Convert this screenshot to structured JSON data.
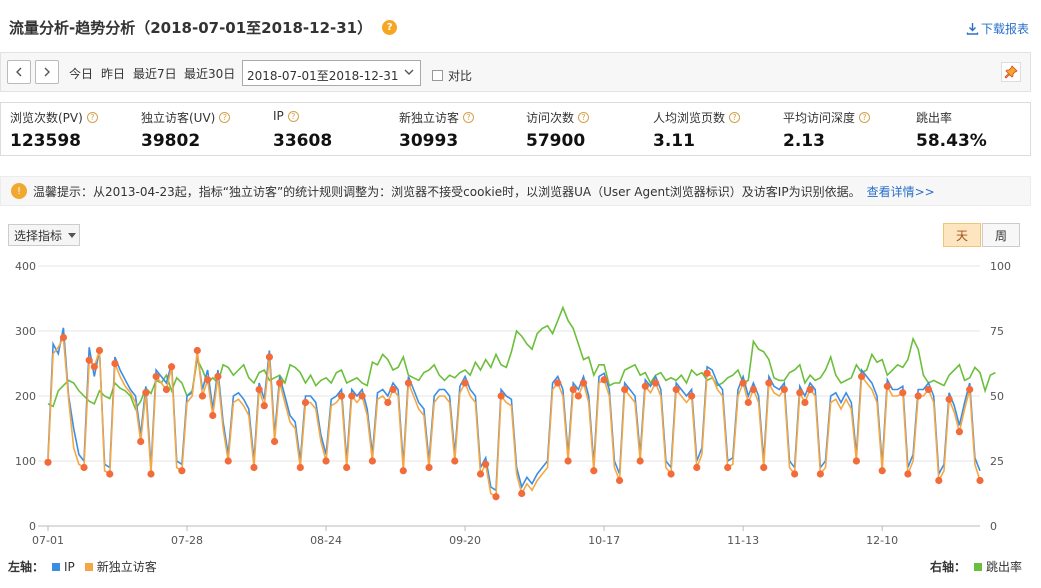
{
  "header": {
    "title": "流量分析-趋势分析（2018-07-01至2018-12-31）",
    "help_icon": "question-icon",
    "download_label": "下载报表",
    "download_icon": "download-icon"
  },
  "toolbar": {
    "prev_icon": "chevron-left-icon",
    "next_icon": "chevron-right-icon",
    "today": "今日",
    "yesterday": "昨日",
    "last7": "最近7日",
    "last30": "最近30日",
    "date_range": "2018-07-01至2018-12-31",
    "compare_label": "对比",
    "compare_checked": false,
    "pin_icon": "pin-icon"
  },
  "metrics": [
    {
      "label": "浏览次数(PV)",
      "value": "123598"
    },
    {
      "label": "独立访客(UV)",
      "value": "39802"
    },
    {
      "label": "IP",
      "value": "33608"
    },
    {
      "label": "新独立访客",
      "value": "30993"
    },
    {
      "label": "访问次数",
      "value": "57900"
    },
    {
      "label": "人均浏览页数",
      "value": "3.11"
    },
    {
      "label": "平均访问深度",
      "value": "2.13"
    },
    {
      "label": "跳出率",
      "value": "58.43%"
    }
  ],
  "notice": {
    "text": "温馨提示：从2013-04-23起，指标“独立访客”的统计规则调整为：浏览器不接受cookie时，以浏览器UA（User Agent浏览器标识）及访客IP为识别依据。",
    "link": "查看详情>>",
    "icon": "info-icon"
  },
  "controls": {
    "select_metric": "选择指标",
    "day": "天",
    "week": "周",
    "active": "day"
  },
  "legend": {
    "left_axis": "左轴：",
    "right_axis": "右轴：",
    "ip": "IP",
    "new_visitors": "新独立访客",
    "bounce": "跳出率"
  },
  "colors": {
    "ip": "#3a8ee6",
    "new_visitors": "#f5a744",
    "bounce": "#6cbf3c",
    "dot": "#f26b3a"
  },
  "chart_data": {
    "type": "line",
    "x_ticks": [
      "07-01",
      "07-28",
      "08-24",
      "09-20",
      "10-17",
      "11-13",
      "12-10"
    ],
    "x_start": "2018-07-01",
    "x_end": "2018-12-31",
    "y_left": {
      "ticks": [
        0,
        100,
        200,
        300,
        400
      ],
      "range": [
        0,
        400
      ]
    },
    "y_right": {
      "ticks": [
        0,
        25,
        50,
        75,
        100
      ],
      "range": [
        0,
        100
      ]
    },
    "grid": true,
    "legend_position": "bottom",
    "series": [
      {
        "name": "IP",
        "axis": "left",
        "values": [
          105,
          280,
          265,
          305,
          200,
          150,
          110,
          100,
          275,
          230,
          270,
          95,
          90,
          260,
          240,
          225,
          210,
          200,
          140,
          215,
          90,
          240,
          230,
          220,
          250,
          100,
          95,
          200,
          205,
          265,
          210,
          240,
          180,
          240,
          160,
          110,
          200,
          205,
          195,
          180,
          100,
          220,
          195,
          270,
          140,
          230,
          200,
          170,
          160,
          100,
          200,
          200,
          190,
          140,
          110,
          195,
          200,
          210,
          100,
          210,
          200,
          210,
          180,
          110,
          205,
          210,
          200,
          220,
          210,
          95,
          230,
          210,
          190,
          180,
          100,
          200,
          210,
          210,
          200,
          110,
          215,
          230,
          210,
          200,
          90,
          105,
          60,
          55,
          210,
          200,
          195,
          90,
          60,
          75,
          65,
          80,
          90,
          100,
          220,
          230,
          210,
          110,
          220,
          210,
          230,
          200,
          95,
          230,
          235,
          210,
          100,
          80,
          220,
          210,
          200,
          110,
          225,
          215,
          230,
          210,
          100,
          90,
          220,
          210,
          200,
          210,
          100,
          120,
          245,
          240,
          220,
          210,
          100,
          105,
          210,
          230,
          200,
          220,
          200,
          100,
          230,
          215,
          210,
          220,
          100,
          90,
          215,
          200,
          220,
          210,
          90,
          100,
          200,
          205,
          190,
          205,
          190,
          110,
          240,
          230,
          220,
          200,
          95,
          225,
          210,
          210,
          215,
          90,
          110,
          210,
          210,
          220,
          200,
          80,
          95,
          205,
          185,
          155,
          190,
          220,
          105,
          85
        ]
      },
      {
        "name": "新独立访客",
        "axis": "left",
        "values": [
          98,
          265,
          275,
          290,
          195,
          120,
          95,
          90,
          255,
          245,
          270,
          85,
          80,
          250,
          230,
          215,
          205,
          190,
          130,
          205,
          80,
          230,
          220,
          210,
          245,
          90,
          85,
          190,
          200,
          270,
          200,
          225,
          170,
          230,
          150,
          100,
          190,
          195,
          185,
          170,
          90,
          210,
          185,
          260,
          130,
          220,
          190,
          160,
          150,
          90,
          190,
          190,
          180,
          130,
          100,
          185,
          190,
          200,
          90,
          200,
          190,
          200,
          170,
          100,
          195,
          200,
          190,
          210,
          200,
          85,
          220,
          200,
          180,
          170,
          90,
          190,
          200,
          200,
          190,
          100,
          205,
          220,
          200,
          190,
          80,
          95,
          50,
          45,
          200,
          190,
          185,
          80,
          50,
          65,
          55,
          70,
          80,
          90,
          210,
          220,
          200,
          100,
          210,
          200,
          220,
          190,
          85,
          220,
          225,
          200,
          90,
          70,
          210,
          200,
          190,
          100,
          215,
          205,
          220,
          200,
          90,
          80,
          210,
          200,
          190,
          200,
          90,
          110,
          235,
          230,
          210,
          200,
          90,
          95,
          200,
          220,
          190,
          210,
          190,
          90,
          220,
          205,
          200,
          210,
          90,
          80,
          205,
          190,
          210,
          200,
          80,
          90,
          190,
          195,
          180,
          195,
          180,
          100,
          230,
          220,
          210,
          190,
          85,
          215,
          200,
          200,
          205,
          80,
          100,
          200,
          200,
          210,
          190,
          70,
          85,
          195,
          175,
          145,
          180,
          210,
          95,
          70
        ]
      },
      {
        "name": "跳出率",
        "axis": "right",
        "values": [
          47,
          46,
          52,
          54,
          56,
          55,
          52,
          50,
          48,
          47,
          52,
          50,
          49,
          55,
          53,
          52,
          50,
          45,
          48,
          53,
          51,
          56,
          55,
          58,
          52,
          57,
          55,
          50,
          52,
          64,
          60,
          55,
          57,
          55,
          62,
          61,
          58,
          60,
          62,
          57,
          55,
          59,
          60,
          56,
          57,
          58,
          55,
          62,
          61,
          59,
          55,
          58,
          54,
          56,
          57,
          55,
          59,
          60,
          55,
          56,
          57,
          55,
          54,
          63,
          62,
          66,
          64,
          60,
          61,
          65,
          58,
          57,
          56,
          59,
          60,
          62,
          58,
          56,
          58,
          57,
          59,
          60,
          58,
          63,
          60,
          64,
          61,
          66,
          62,
          61,
          67,
          75,
          73,
          70,
          68,
          74,
          76,
          77,
          74,
          79,
          84,
          79,
          76,
          70,
          64,
          65,
          58,
          62,
          62,
          54,
          55,
          55,
          60,
          61,
          62,
          58,
          59,
          55,
          58,
          59,
          56,
          57,
          56,
          58,
          55,
          60,
          58,
          59,
          56,
          57,
          54,
          55,
          57,
          58,
          60,
          55,
          56,
          71,
          68,
          67,
          64,
          57,
          56,
          56,
          59,
          60,
          62,
          55,
          58,
          56,
          57,
          60,
          65,
          58,
          55,
          56,
          57,
          62,
          59,
          60,
          66,
          63,
          64,
          58,
          60,
          62,
          61,
          64,
          72,
          68,
          58,
          55,
          56,
          55,
          54,
          58,
          60,
          62,
          56,
          57,
          61,
          59,
          52,
          58,
          59
        ]
      }
    ],
    "highlighted_points": "新独立访客"
  }
}
